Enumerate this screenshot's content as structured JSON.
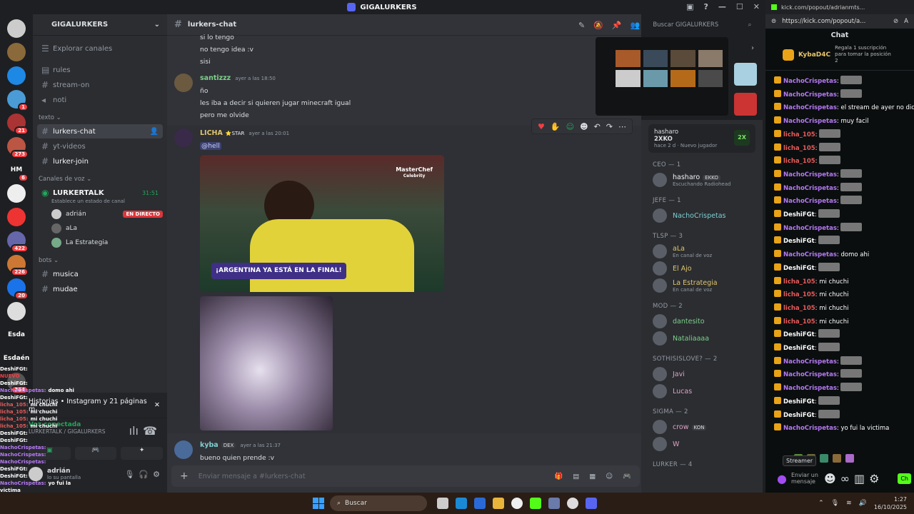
{
  "window": {
    "title": "GIGALURKERS"
  },
  "servers": [
    {
      "label": "",
      "color": "#ccc",
      "badge": ""
    },
    {
      "label": "",
      "color": "#8a6a3a",
      "badge": ""
    },
    {
      "label": "",
      "color": "#1e88e5",
      "badge": ""
    },
    {
      "label": "",
      "color": "#4a9bd6",
      "badge": "1"
    },
    {
      "label": "",
      "color": "#a33",
      "badge": "21"
    },
    {
      "label": "",
      "color": "#b54",
      "badge": "273"
    },
    {
      "label": "HM",
      "color": "#1e1f22",
      "badge": "6"
    },
    {
      "label": "",
      "color": "#eee",
      "badge": ""
    },
    {
      "label": "",
      "color": "#e33",
      "badge": ""
    },
    {
      "label": "",
      "color": "#66a",
      "badge": "422"
    },
    {
      "label": "",
      "color": "#c73",
      "badge": "226"
    },
    {
      "label": "",
      "color": "#1a73e8",
      "badge": "20"
    },
    {
      "label": "",
      "color": "#ddd",
      "badge": ""
    },
    {
      "label": "Esda",
      "color": "#1e1f22",
      "badge": ""
    },
    {
      "label": "Esdaén",
      "color": "#1e1f22",
      "badge": ""
    },
    {
      "label": "",
      "color": "#555",
      "badge": "364"
    }
  ],
  "sidebar": {
    "guild_name": "GIGALURKERS",
    "explore": "Explorar canales",
    "top": [
      "rules",
      "stream-on",
      "noti"
    ],
    "cat_text": "texto",
    "text": [
      "lurkers-chat",
      "yt-videos",
      "lurker-join"
    ],
    "cat_voice": "Canales de voz",
    "voice_name": "LURKERTALK",
    "voice_time": "31:51",
    "voice_status": "Establece un estado de canal",
    "voice_users": [
      "adrián",
      "aLa",
      "La Estrategia"
    ],
    "live": "EN DIRECTO",
    "cat_bots": "bots",
    "bots": [
      "musica",
      "mudae"
    ],
    "activity": "Historias • Instagram y 21 páginas m...",
    "voice_connected": "Voz conectada",
    "voice_path": "LURKERTALK / GIGALURKERS",
    "user": "adrián",
    "user_status": "lo su pantalla"
  },
  "header": {
    "channel": "lurkers-chat",
    "search": "Buscar GIGALURKERS"
  },
  "messages": {
    "m0": [
      "si lo tengo",
      "no tengo idea :v",
      "sisi"
    ],
    "m1_user": "santizzz",
    "m1_time": "ayer a las 18:50",
    "m1": [
      "ño",
      "les iba a decir si quieren jugar minecraft igual",
      "pero me olvide"
    ],
    "m2_user": "LICHA",
    "m2_tag": "STAR",
    "m2_time": "ayer a las 20:01",
    "m2_mention": "@hell",
    "gif_text": "¡ARGENTINA YA ESTÁ EN LA FINAL!",
    "gif_brand": "MasterChef",
    "gif_brand_sub": "Celebrity",
    "m3_user": "kyba",
    "m3_tag": "DEX",
    "m3_time": "ayer a las 21:37",
    "m3": "bueno quien prende :v"
  },
  "composer": {
    "placeholder": "Enviar mensaje a #lurkers-chat"
  },
  "members": {
    "activity": {
      "user": "hasharo",
      "game": "2XKO",
      "time": "hace 2 d",
      "detail": "Nuevo jugador"
    },
    "cats": [
      {
        "title": "CEO — 1",
        "users": [
          {
            "name": "hasharo",
            "tag": "EKKO",
            "sub": "Escuchando Radiohead",
            "color": "#f2f3f5"
          }
        ]
      },
      {
        "title": "JEFE — 1",
        "users": [
          {
            "name": "NachoCrispetas",
            "tag": "",
            "sub": "",
            "color": "#7ecfd3"
          }
        ]
      },
      {
        "title": "TLSP — 3",
        "users": [
          {
            "name": "aLa",
            "tag": "",
            "sub": "En canal de voz",
            "color": "#e0c56e"
          },
          {
            "name": "El Ajo",
            "tag": "",
            "sub": "",
            "color": "#e0c56e"
          },
          {
            "name": "La Estrategia",
            "tag": "",
            "sub": "En canal de voz",
            "color": "#e0c56e"
          }
        ]
      },
      {
        "title": "MOD — 2",
        "users": [
          {
            "name": "dantesito",
            "tag": "",
            "sub": "",
            "color": "#7ecf8a"
          },
          {
            "name": "Nataliaaaa",
            "tag": "",
            "sub": "",
            "color": "#7ecf8a"
          }
        ]
      },
      {
        "title": "SOTHISISLOVE? — 2",
        "users": [
          {
            "name": "Javi",
            "tag": "",
            "sub": "",
            "color": "#e0a0c8"
          },
          {
            "name": "Lucas",
            "tag": "",
            "sub": "",
            "color": "#e0a0c8"
          }
        ]
      },
      {
        "title": "SIGMA — 2",
        "users": [
          {
            "name": "crow",
            "tag": "KON",
            "sub": "",
            "color": "#e0a0c8"
          },
          {
            "name": "W",
            "tag": "",
            "sub": "",
            "color": "#e0a0c8"
          }
        ]
      },
      {
        "title": "LURKER — 4",
        "users": []
      }
    ]
  },
  "kick": {
    "url": "https://kick.com/popout/a...",
    "url_top": "kick.com/popout/adrianmts...",
    "chat_title": "Chat",
    "top_user": "KybaD4C",
    "top_note": "Regala 1 suscripción para tomar la posición 2",
    "lines": [
      {
        "u": "NachoCrispetas",
        "c": "#b67af5",
        "t": ""
      },
      {
        "u": "NachoCrispetas",
        "c": "#b67af5",
        "t": ""
      },
      {
        "u": "NachoCrispetas",
        "c": "#b67af5",
        "t": "el stream de ayer no dice lo mismo"
      },
      {
        "u": "NachoCrispetas",
        "c": "#b67af5",
        "t": "muy facil"
      },
      {
        "u": "licha_105",
        "c": "#e85a5a",
        "t": ""
      },
      {
        "u": "licha_105",
        "c": "#e85a5a",
        "t": ""
      },
      {
        "u": "licha_105",
        "c": "#e85a5a",
        "t": ""
      },
      {
        "u": "NachoCrispetas",
        "c": "#b67af5",
        "t": ""
      },
      {
        "u": "NachoCrispetas",
        "c": "#b67af5",
        "t": ""
      },
      {
        "u": "NachoCrispetas",
        "c": "#b67af5",
        "t": ""
      },
      {
        "u": "DeshiFGt",
        "c": "#fff",
        "t": ""
      },
      {
        "u": "NachoCrispetas",
        "c": "#b67af5",
        "t": ""
      },
      {
        "u": "DeshiFGt",
        "c": "#fff",
        "t": ""
      },
      {
        "u": "NachoCrispetas",
        "c": "#b67af5",
        "t": "domo ahi"
      },
      {
        "u": "DeshiFGt",
        "c": "#fff",
        "t": ""
      },
      {
        "u": "licha_105",
        "c": "#e85a5a",
        "t": "mi chuchi"
      },
      {
        "u": "licha_105",
        "c": "#e85a5a",
        "t": "mi chuchi"
      },
      {
        "u": "licha_105",
        "c": "#e85a5a",
        "t": "mi chuchi"
      },
      {
        "u": "licha_105",
        "c": "#e85a5a",
        "t": "mi chuchi"
      },
      {
        "u": "DeshiFGt",
        "c": "#fff",
        "t": ""
      },
      {
        "u": "DeshiFGt",
        "c": "#fff",
        "t": ""
      },
      {
        "u": "NachoCrispetas",
        "c": "#b67af5",
        "t": ""
      },
      {
        "u": "NachoCrispetas",
        "c": "#b67af5",
        "t": ""
      },
      {
        "u": "NachoCrispetas",
        "c": "#b67af5",
        "t": ""
      },
      {
        "u": "DeshiFGt",
        "c": "#fff",
        "t": ""
      },
      {
        "u": "DeshiFGt",
        "c": "#fff",
        "t": ""
      },
      {
        "u": "NachoCrispetas",
        "c": "#b67af5",
        "t": "yo fui la victima"
      }
    ],
    "streamer_tooltip": "Streamer",
    "send_placeholder": "Enviar un mensaje",
    "send_button": "Ch"
  },
  "overlay_lines": [
    {
      "u": "DeshiFGt:",
      "t": ""
    },
    {
      "u": "NUEVO",
      "t": ""
    },
    {
      "u": "DeshiFGt:",
      "t": ""
    },
    {
      "u": "NachoCrispetas:",
      "t": "domo ahi"
    },
    {
      "u": "DeshiFGt:",
      "t": ""
    },
    {
      "u": "licha_105:",
      "t": "mi chuchi"
    },
    {
      "u": "licha_105:",
      "t": "mi chuchi"
    },
    {
      "u": "licha_105:",
      "t": "mi chuchi"
    },
    {
      "u": "licha_105:",
      "t": "mi chuchi"
    },
    {
      "u": "DeshiFGt:",
      "t": ""
    },
    {
      "u": "DeshiFGt:",
      "t": ""
    },
    {
      "u": "NachoCrispetas:",
      "t": ""
    },
    {
      "u": "NachoCrispetas:",
      "t": ""
    },
    {
      "u": "NachoCrispetas:",
      "t": ""
    },
    {
      "u": "DeshiFGt:",
      "t": ""
    },
    {
      "u": "DeshiFGt:",
      "t": ""
    },
    {
      "u": "NachoCrispetas:",
      "t": "yo fui la victima"
    }
  ],
  "taskbar": {
    "search": "Buscar",
    "time": "1:27",
    "date": "16/10/2025"
  }
}
